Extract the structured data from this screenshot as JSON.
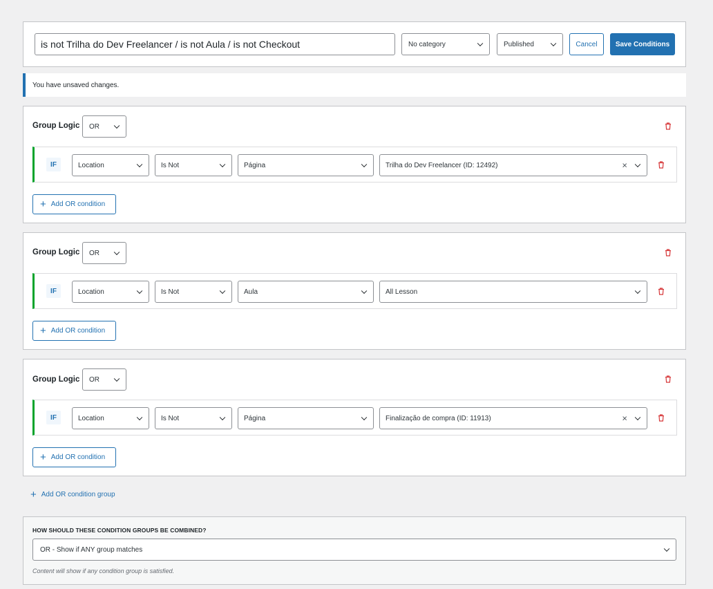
{
  "header": {
    "title_value": "is not Trilha do Dev Freelancer / is not Aula / is not Checkout",
    "category": "No category",
    "status": "Published",
    "cancel_label": "Cancel",
    "save_label": "Save Conditions"
  },
  "notice": "You have unsaved changes.",
  "groups": [
    {
      "logic_label": "Group Logic",
      "logic_value": "OR",
      "condition": {
        "if": "IF",
        "field": "Location",
        "operator": "Is Not",
        "type": "Página",
        "value": "Trilha do Dev Freelancer (ID: 12492)",
        "clear": "×"
      },
      "add_or_label": "Add OR condition"
    },
    {
      "logic_label": "Group Logic",
      "logic_value": "OR",
      "condition": {
        "if": "IF",
        "field": "Location",
        "operator": "Is Not",
        "type": "Aula",
        "value": "All Lesson"
      },
      "add_or_label": "Add OR condition"
    },
    {
      "logic_label": "Group Logic",
      "logic_value": "OR",
      "condition": {
        "if": "IF",
        "field": "Location",
        "operator": "Is Not",
        "type": "Página",
        "value": "Finalização de compra (ID: 11913)",
        "clear": "×"
      },
      "add_or_label": "Add OR condition"
    }
  ],
  "add_group_label": "Add OR condition group",
  "combine": {
    "label": "HOW SHOULD THESE CONDITION GROUPS BE COMBINED?",
    "value": "OR - Show if ANY group matches",
    "help": "Content will show if any condition group is satisfied."
  },
  "colors": {
    "accent": "#2271b1",
    "success": "#00a32a",
    "danger": "#d63638"
  }
}
